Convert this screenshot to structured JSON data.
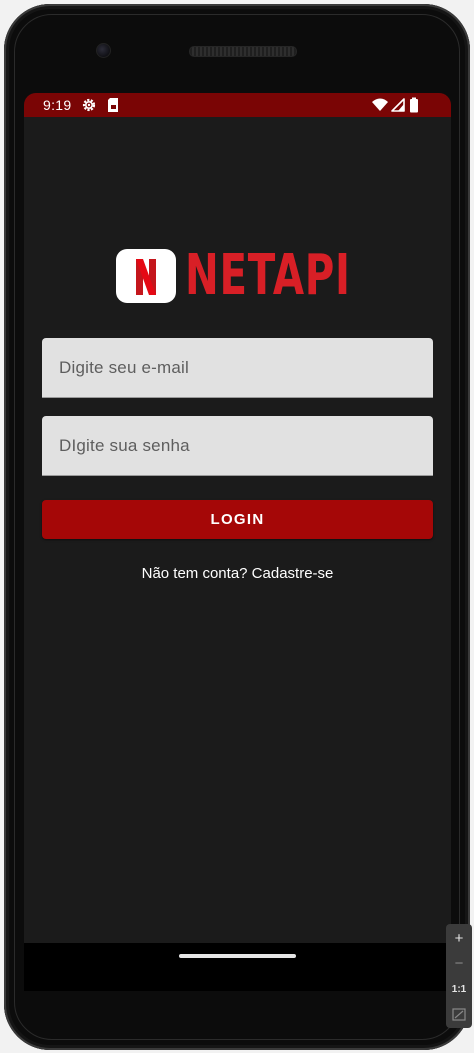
{
  "status_bar": {
    "time": "9:19",
    "background": "#7a0505",
    "icons": [
      "settings-gear-icon",
      "sim-card-icon",
      "wifi-icon",
      "cellular-signal-icon",
      "battery-icon"
    ]
  },
  "logo": {
    "badge_letter": "N",
    "wordmark": "NETAPI",
    "color": "#d81f26"
  },
  "form": {
    "email_placeholder": "Digite seu e-mail",
    "password_placeholder": "DIgite sua senha",
    "login_label": "LOGIN",
    "signup_text": "Não tem conta? Cadastre-se"
  },
  "colors": {
    "screen_background": "#1b1b1b",
    "button": "#a50707",
    "input_background": "#e1e1e1"
  },
  "emulator_toolbar": {
    "zoom_in": "+",
    "zoom_out": "−",
    "one_to_one": "1:1"
  }
}
